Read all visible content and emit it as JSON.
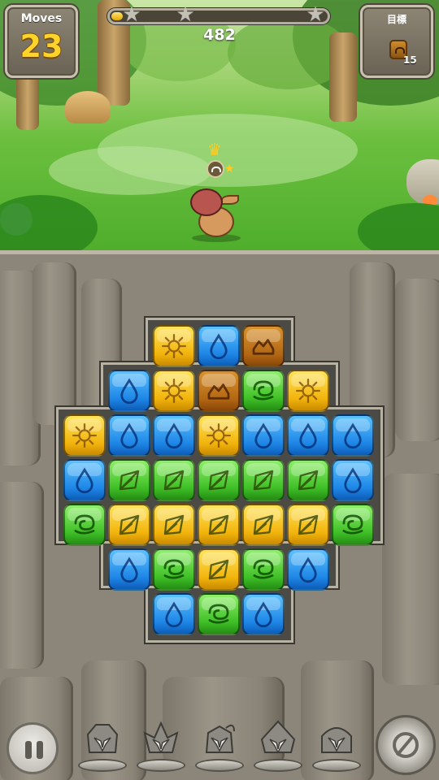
{
  "hud": {
    "moves_label": "Moves",
    "moves_value": "23",
    "score": "482",
    "goal_label": "目標",
    "goal_count": "15",
    "goal_icon": "brown-mountain-block-icon",
    "progress_fraction": 0.04,
    "stars_total": 3
  },
  "board": {
    "rows": [
      [
        "",
        "",
        "yellow-sun",
        "blue-drop",
        "brown-mountain",
        "",
        ""
      ],
      [
        "",
        "blue-drop",
        "yellow-sun",
        "brown-mountain",
        "green-swirl",
        "yellow-sun",
        ""
      ],
      [
        "yellow-sun",
        "blue-drop",
        "blue-drop",
        "yellow-sun",
        "blue-drop",
        "blue-drop",
        "blue-drop"
      ],
      [
        "blue-drop",
        "green-leaf",
        "green-leaf",
        "green-leaf",
        "green-leaf",
        "green-leaf",
        "blue-drop"
      ],
      [
        "green-swirl",
        "yellow-leaf",
        "yellow-leaf",
        "yellow-leaf",
        "yellow-leaf",
        "yellow-leaf",
        "green-swirl"
      ],
      [
        "",
        "blue-drop",
        "green-swirl",
        "yellow-leaf",
        "green-swirl",
        "blue-drop",
        ""
      ],
      [
        "",
        "",
        "blue-drop",
        "green-swirl",
        "blue-drop",
        "",
        ""
      ]
    ]
  },
  "bottom_bar": {
    "pause_icon": "pause-icon",
    "boosters": [
      "booster-stone-golem-icon",
      "booster-stone-winged-icon",
      "booster-stone-knight-icon",
      "booster-stone-wizard-icon",
      "booster-stone-helmet-icon"
    ],
    "skill_icon": "disabled-skill-icon"
  },
  "colors": {
    "yellow": "#f2b40c",
    "blue": "#1e86e6",
    "green": "#3fbf27",
    "brown": "#b36814",
    "moves_text": "#ffd42a"
  }
}
